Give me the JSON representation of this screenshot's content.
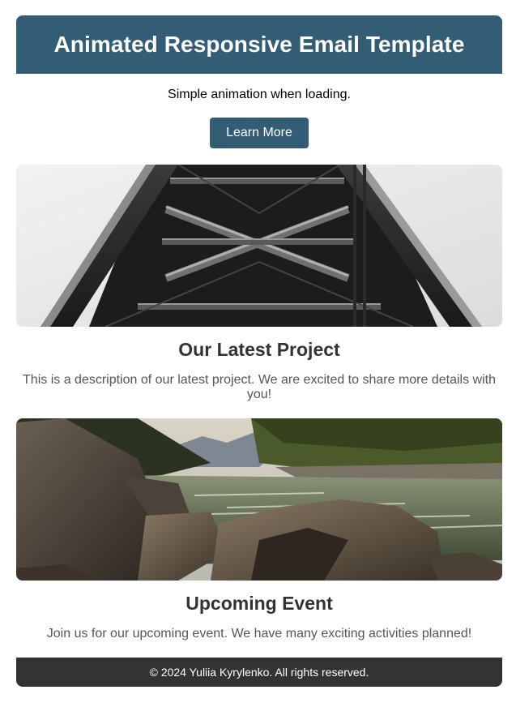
{
  "header": {
    "title": "Animated Responsive Email Template"
  },
  "intro": {
    "text": "Simple animation when loading.",
    "button_label": "Learn More"
  },
  "project": {
    "image_alt": "bridge-image",
    "title": "Our Latest Project",
    "description": "This is a description of our latest project. We are excited to share more details with you!"
  },
  "event": {
    "image_alt": "river-image",
    "title": "Upcoming Event",
    "description": "Join us for our upcoming event. We have many exciting activities planned!"
  },
  "footer": {
    "text": "© 2024 Yuliia Kyrylenko. All rights reserved."
  },
  "colors": {
    "brand": "#335c75",
    "footer_bg": "#333333",
    "heading": "#333333",
    "body_text": "#555555"
  }
}
